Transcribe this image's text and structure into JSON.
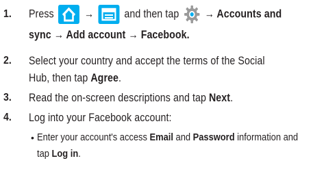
{
  "steps": [
    {
      "num": "1.",
      "lines": {
        "press": "Press",
        "arrow1": "→",
        "and_then_tap": "and then tap",
        "accounts_sync": "→ Accounts and",
        "line2": "sync → Add account → Facebook."
      },
      "icons": [
        "home-icon",
        "menu-icon",
        "settings-gear-icon"
      ],
      "colors": {
        "icon_bg": "#00aeef",
        "gear": "#9a9a9a"
      }
    },
    {
      "num": "2.",
      "line1": "Select your country and accept the terms of the Social",
      "line2_pre": "Hub, then tap ",
      "line2_bold": "Agree",
      "line2_post": "."
    },
    {
      "num": "3.",
      "pre": "Read the on-screen descriptions and tap ",
      "bold": "Next",
      "post": "."
    },
    {
      "num": "4.",
      "text": "Log into your Facebook account:"
    }
  ],
  "sub_bullet": {
    "bullet": "•",
    "pre": "Enter your account's access ",
    "email": "Email",
    "and": " and ",
    "password": "Password",
    "post": " information and",
    "line2_pre": "tap ",
    "line2_bold": "Log in",
    "line2_post": "."
  }
}
